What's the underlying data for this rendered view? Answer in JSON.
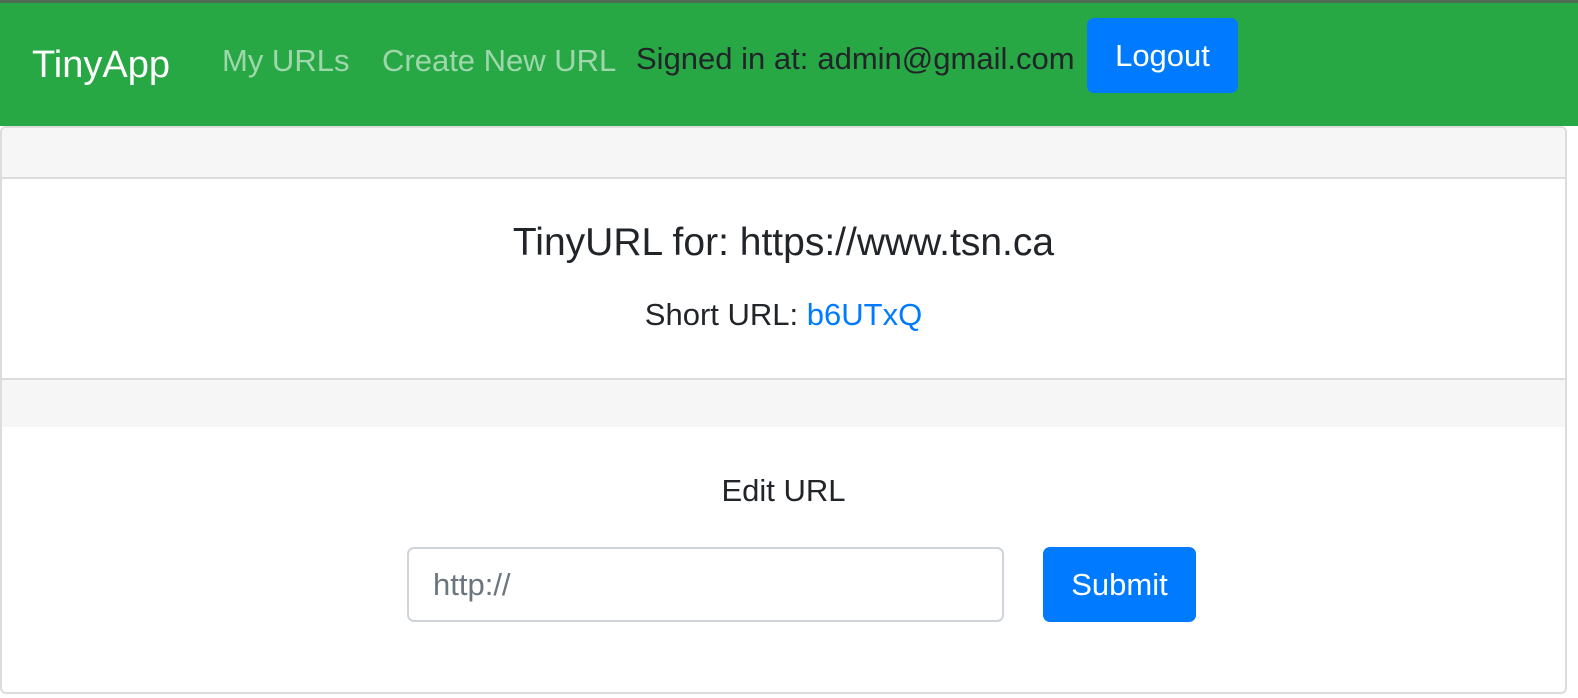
{
  "navbar": {
    "brand": "TinyApp",
    "links": [
      "My URLs",
      "Create New URL"
    ],
    "signed_in_label": "Signed in at:",
    "signed_in_email": "admin@gmail.com",
    "logout_label": "Logout",
    "background_color": "#28a745",
    "button_color": "#007bff"
  },
  "url_card": {
    "title_prefix": "TinyURL for:",
    "long_url": "https://www.tsn.ca",
    "short_url_label": "Short URL:",
    "short_url_id": "b6UTxQ",
    "link_color": "#007bff"
  },
  "edit_form": {
    "title": "Edit URL",
    "input_placeholder": "http://",
    "input_value": "",
    "submit_label": "Submit"
  }
}
